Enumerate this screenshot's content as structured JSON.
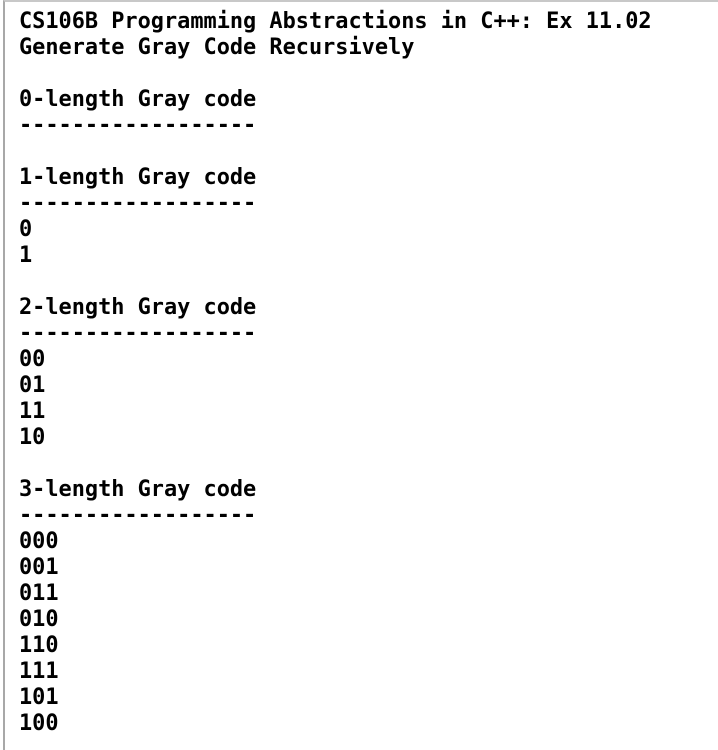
{
  "lines": [
    "CS106B Programming Abstractions in C++: Ex 11.02",
    "Generate Gray Code Recursively",
    "",
    "0-length Gray code",
    "------------------",
    "",
    "1-length Gray code",
    "------------------",
    "0",
    "1",
    "",
    "2-length Gray code",
    "------------------",
    "00",
    "01",
    "11",
    "10",
    "",
    "3-length Gray code",
    "------------------",
    "000",
    "001",
    "011",
    "010",
    "110",
    "111",
    "101",
    "100"
  ]
}
